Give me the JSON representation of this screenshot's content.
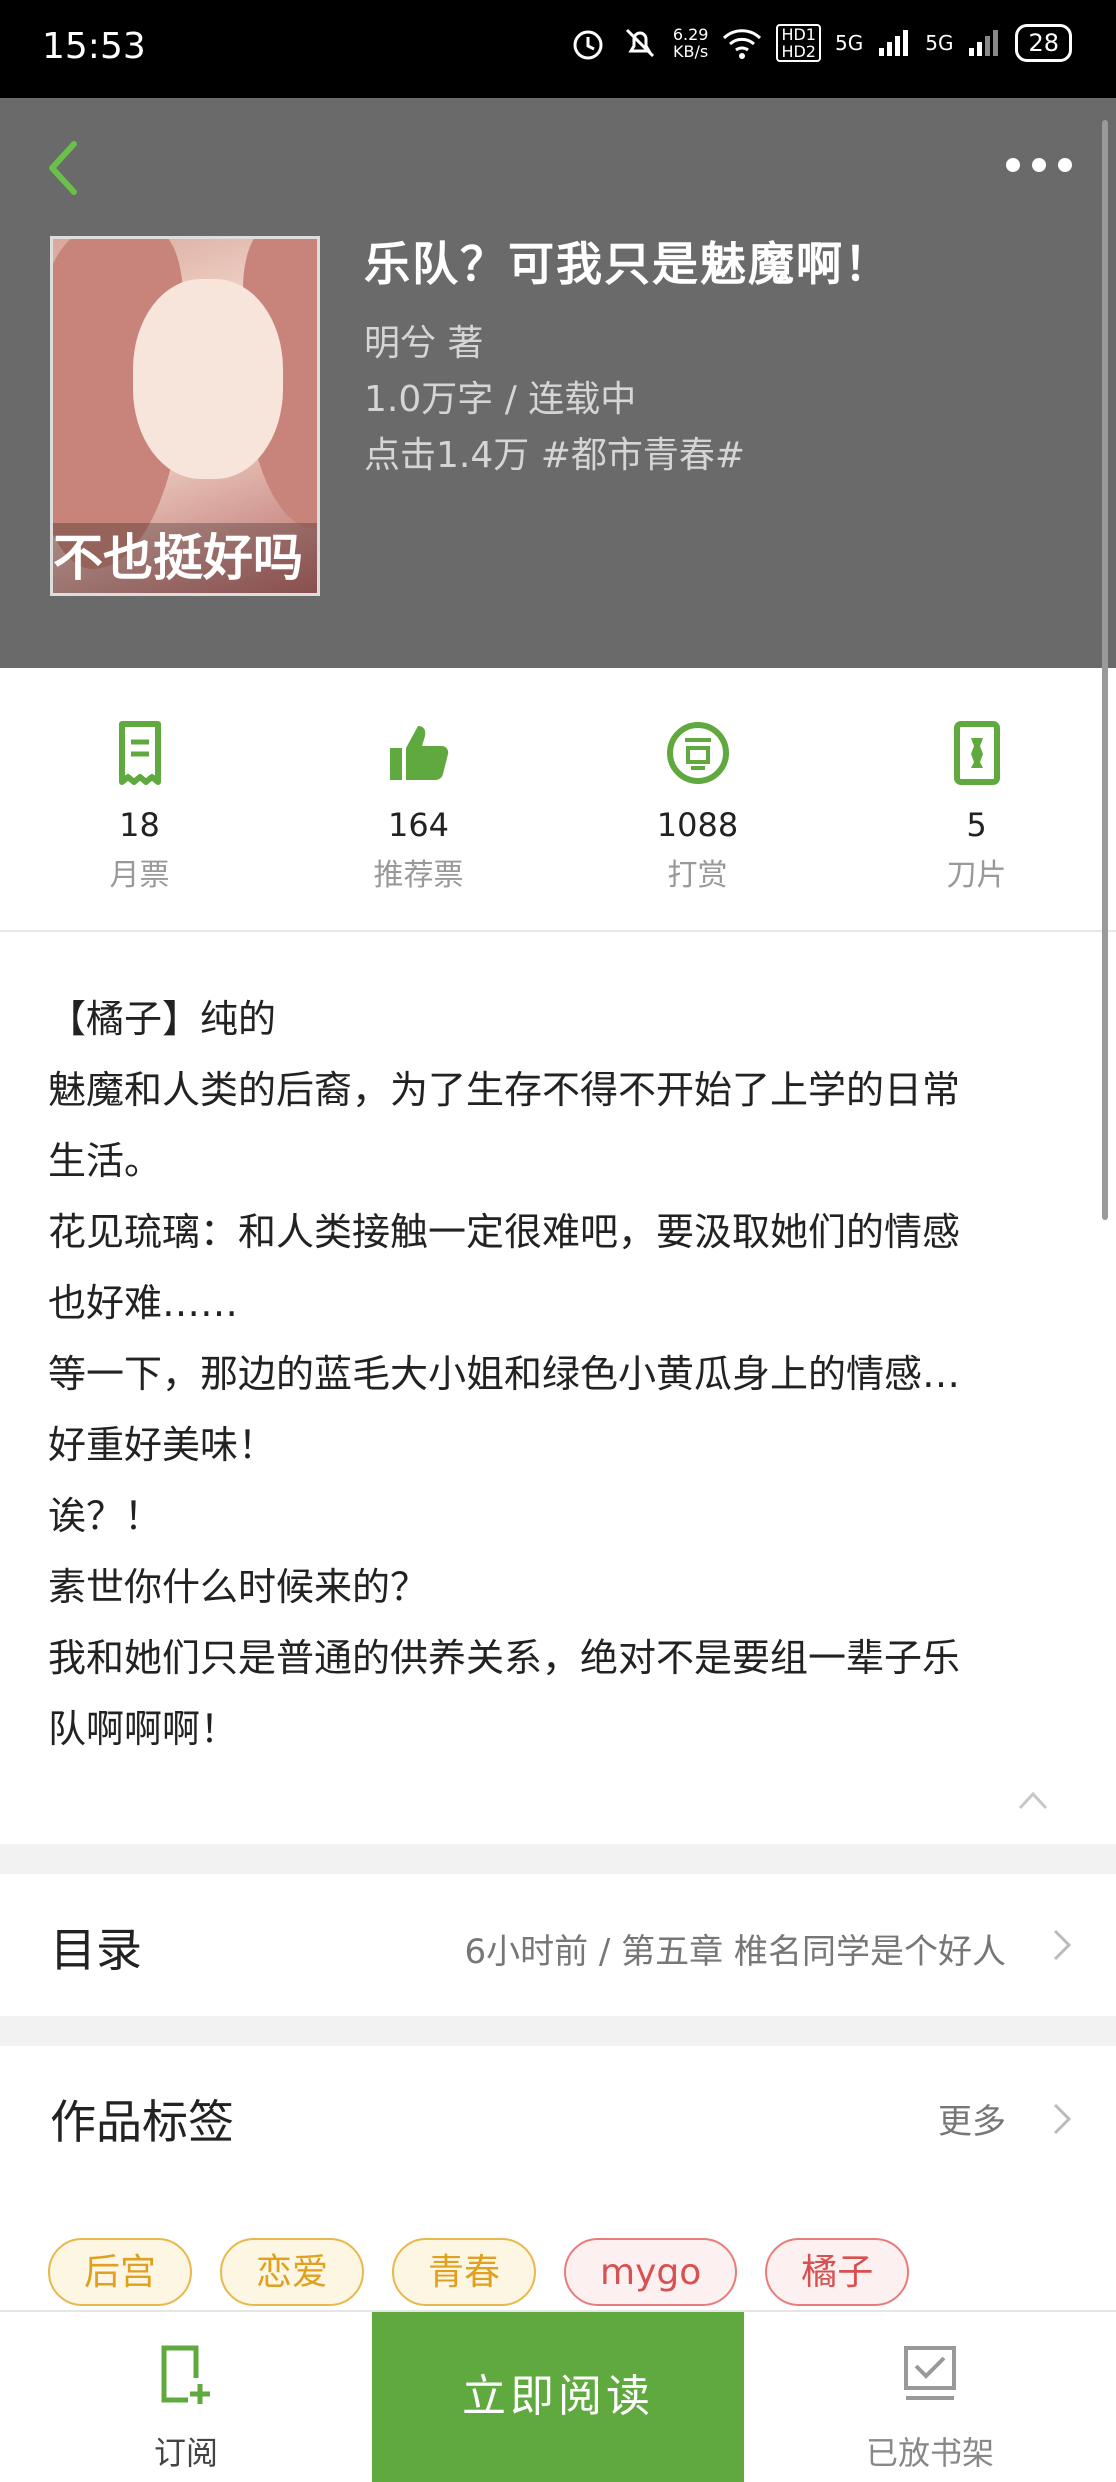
{
  "status_bar": {
    "time": "15:53",
    "net_speed_top": "6.29",
    "net_speed_bottom": "KB/s",
    "signal1": "5G",
    "signal2": "5G",
    "hd1": "HD1",
    "hd2": "HD2",
    "battery": "28"
  },
  "book": {
    "title": "乐队？可我只是魅魔啊！",
    "author": "明兮  著",
    "words_status": "1.0万字 / 连载中",
    "clicks_genre": "点击1.4万  #都市青春#",
    "cover_caption": "不也挺好吗"
  },
  "stats": [
    {
      "value": "18",
      "label": "月票",
      "icon": "monthly-ticket-icon"
    },
    {
      "value": "164",
      "label": "推荐票",
      "icon": "thumbs-up-icon"
    },
    {
      "value": "1088",
      "label": "打赏",
      "icon": "reward-icon"
    },
    {
      "value": "5",
      "label": "刀片",
      "icon": "blade-icon"
    }
  ],
  "description": [
    "【橘子】纯的",
    "魅魔和人类的后裔，为了生存不得不开始了上学的日常",
    "生活。",
    "花见琉璃：和人类接触一定很难吧，要汲取她们的情感",
    "也好难……",
    "等一下，那边的蓝毛大小姐和绿色小黄瓜身上的情感…",
    "好重好美味！",
    "诶？！",
    "素世你什么时候来的？",
    "我和她们只是普通的供养关系，绝对不是要组一辈子乐",
    "队啊啊啊！"
  ],
  "catalog": {
    "label": "目录",
    "latest": "6小时前 / 第五章  椎名同学是个好人"
  },
  "tags_section": {
    "label": "作品标签",
    "more": "更多",
    "tags": [
      "后宫",
      "恋爱",
      "青春",
      "mygo",
      "橘子"
    ]
  },
  "bottom_bar": {
    "subscribe": "订阅",
    "read_now": "立即阅读",
    "on_shelf": "已放书架"
  },
  "colors": {
    "accent": "#5fa93f",
    "header_bg": "#6a6a6a"
  }
}
